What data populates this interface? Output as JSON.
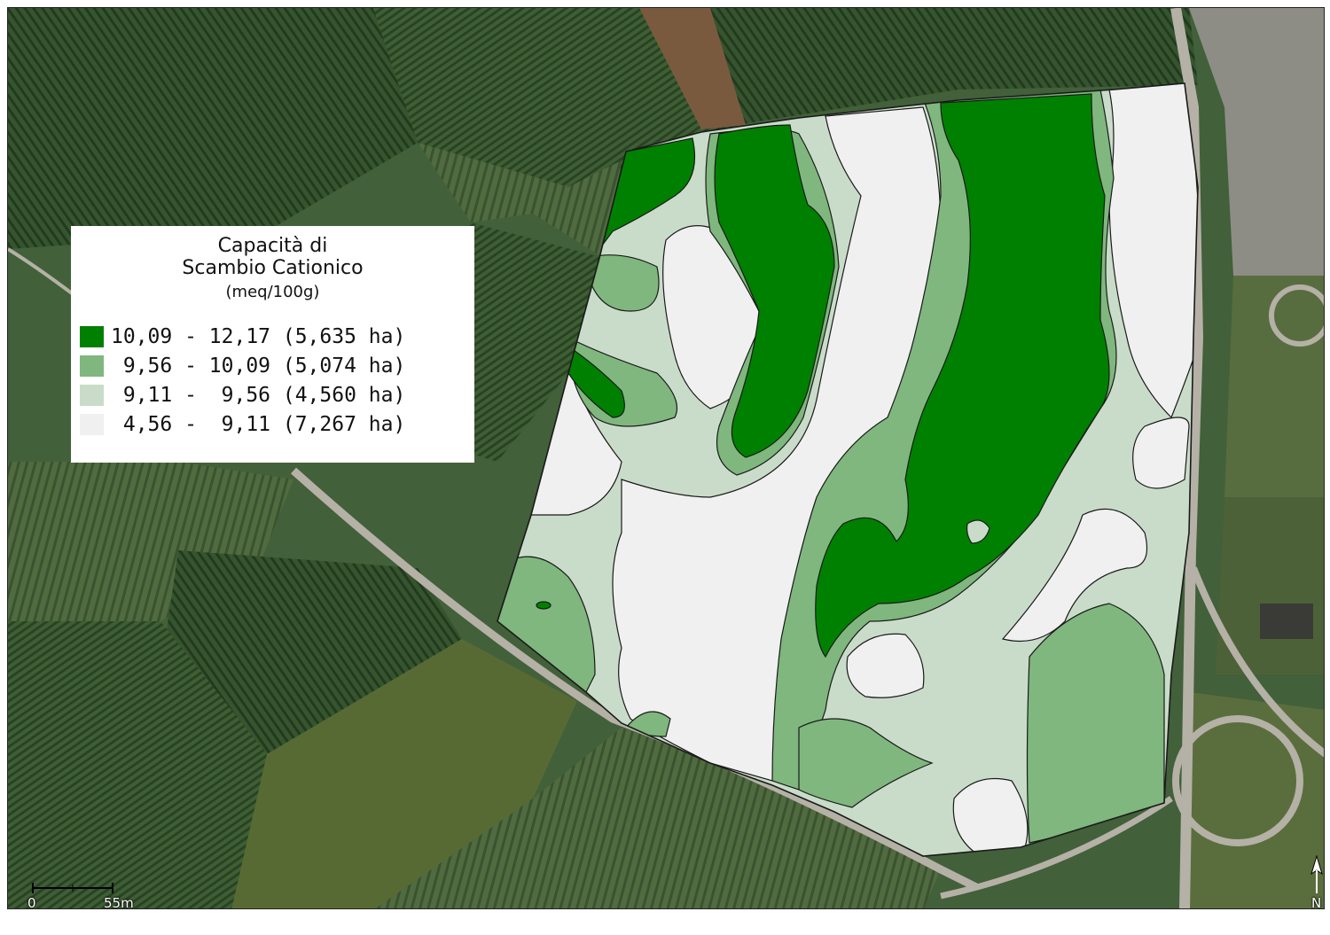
{
  "legend": {
    "title_line1": "Capacità di",
    "title_line2": "Scambio Cationico",
    "unit": "(meq/100g)",
    "classes": [
      {
        "label": "10,09 - 12,17 (5,635 ha)",
        "color": "#008000",
        "range": [
          10.09,
          12.17
        ],
        "area_ha": 5.635
      },
      {
        "label": " 9,56 - 10,09 (5,074 ha)",
        "color": "#7fb77e",
        "range": [
          9.56,
          10.09
        ],
        "area_ha": 5.074
      },
      {
        "label": " 9,11 -  9,56 (4,560 ha)",
        "color": "#c9dcc9",
        "range": [
          9.11,
          9.56
        ],
        "area_ha": 4.56
      },
      {
        "label": " 4,56 -  9,11 (7,267 ha)",
        "color": "#f0f0f0",
        "range": [
          4.56,
          9.11
        ],
        "area_ha": 7.267
      }
    ]
  },
  "scale_bar": {
    "start_label": "0",
    "end_label": "55m"
  },
  "north_arrow": {
    "label": "N"
  },
  "colors": {
    "field_dark": "#2f4a29",
    "field_mid": "#4d6a3f",
    "road": "#b5b1a6",
    "outline": "#1a1a1a"
  }
}
